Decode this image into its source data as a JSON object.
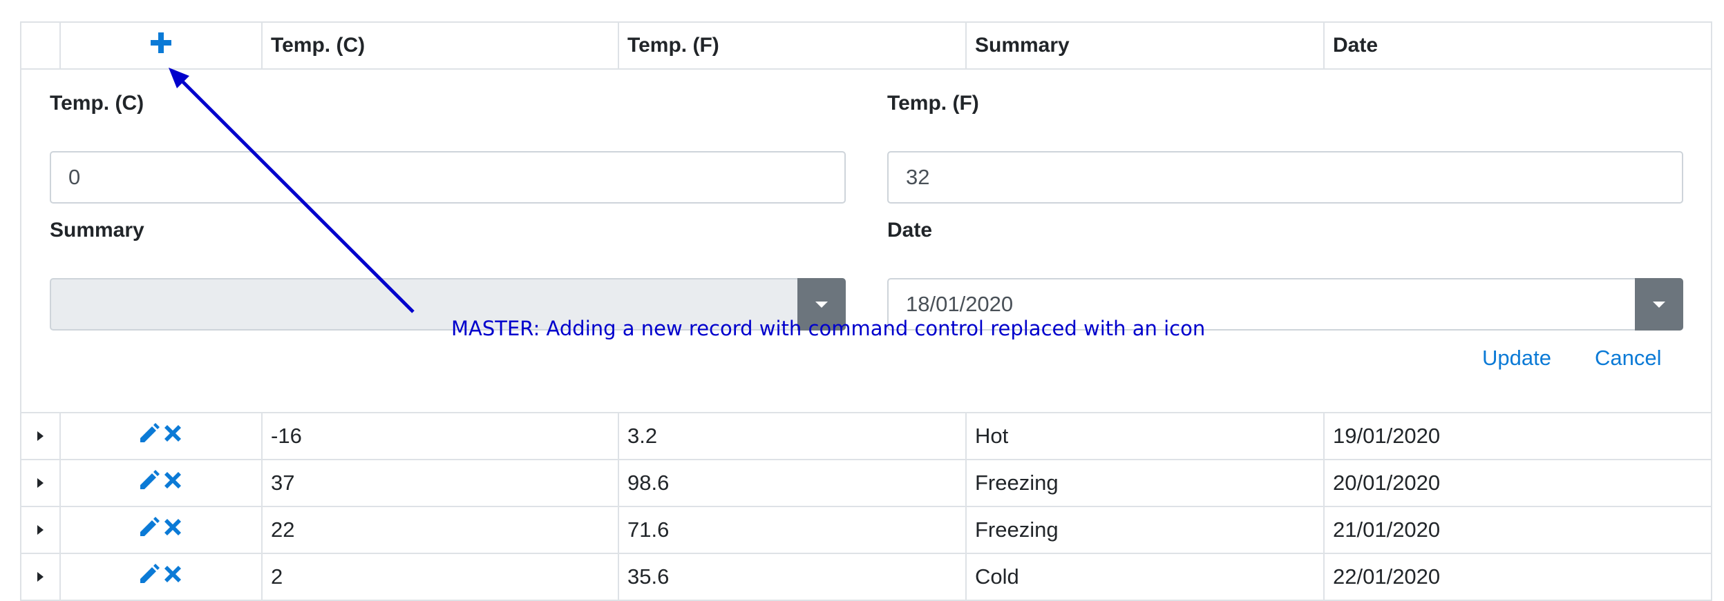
{
  "grid": {
    "columns": [
      "Temp. (C)",
      "Temp. (F)",
      "Summary",
      "Date"
    ],
    "add_icon": "plus-icon",
    "edit_icon": "pencil-icon",
    "delete_icon": "x-icon",
    "accent_color": "#0b7ad6"
  },
  "edit_form": {
    "temp_c_label": "Temp. (C)",
    "temp_c_value": "0",
    "temp_f_label": "Temp. (F)",
    "temp_f_value": "32",
    "summary_label": "Summary",
    "summary_value": "",
    "date_label": "Date",
    "date_value": "18/01/2020",
    "update_label": "Update",
    "cancel_label": "Cancel"
  },
  "rows": [
    {
      "temp_c": "-16",
      "temp_f": "3.2",
      "summary": "Hot",
      "date": "19/01/2020"
    },
    {
      "temp_c": "37",
      "temp_f": "98.6",
      "summary": "Freezing",
      "date": "20/01/2020"
    },
    {
      "temp_c": "22",
      "temp_f": "71.6",
      "summary": "Freezing",
      "date": "21/01/2020"
    },
    {
      "temp_c": "2",
      "temp_f": "35.6",
      "summary": "Cold",
      "date": "22/01/2020"
    }
  ],
  "annotation": {
    "text": "MASTER: Adding a new record with command control replaced with an icon",
    "color": "#0000cc"
  }
}
